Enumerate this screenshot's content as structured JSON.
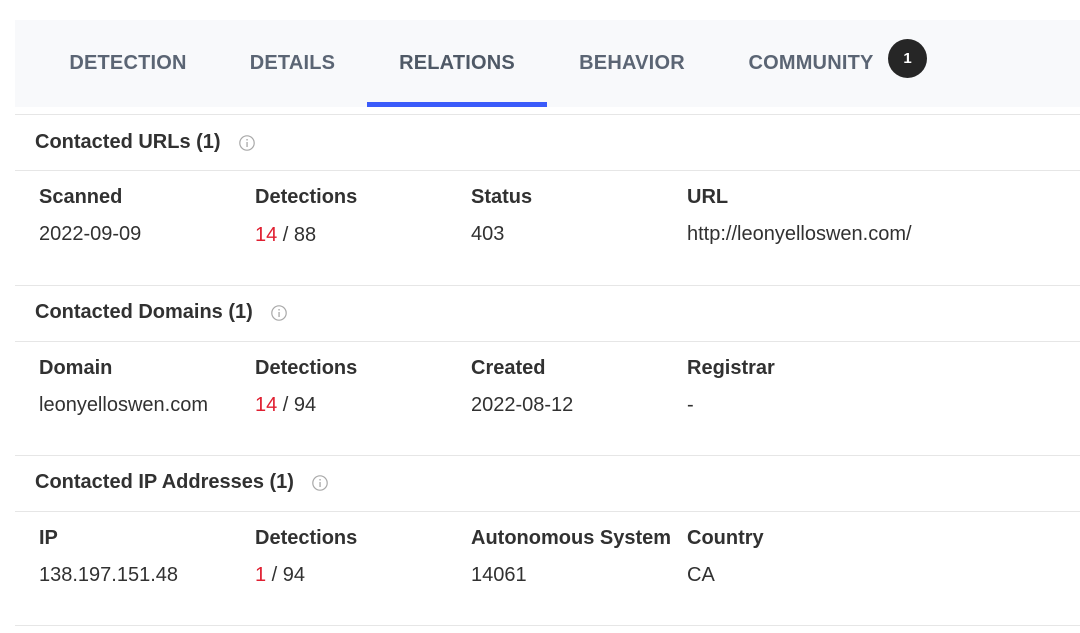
{
  "tabs": [
    {
      "label": "DETECTION"
    },
    {
      "label": "DETAILS"
    },
    {
      "label": "RELATIONS"
    },
    {
      "label": "BEHAVIOR"
    },
    {
      "label": "COMMUNITY"
    }
  ],
  "community_badge": "1",
  "active_tab": "RELATIONS",
  "colors": {
    "accent": "#3b5bfa",
    "malicious": "#e02032",
    "text": "#313131",
    "tab_text": "#5b6574"
  },
  "sections": [
    {
      "title": "Contacted URLs (1)",
      "info_icon": "info-icon",
      "columns": [
        "Scanned",
        "Detections",
        "Status",
        "URL"
      ],
      "rows": [
        {
          "c1": "2022-09-09",
          "det_pos": "14",
          "det_sep": " / ",
          "det_total": "88",
          "c3": "403",
          "c4": "http://leonyelloswen.com/"
        }
      ]
    },
    {
      "title": "Contacted Domains (1)",
      "info_icon": "info-icon",
      "columns": [
        "Domain",
        "Detections",
        "Created",
        "Registrar"
      ],
      "rows": [
        {
          "c1": "leonyelloswen.com",
          "det_pos": "14",
          "det_sep": " / ",
          "det_total": "94",
          "c3": "2022-08-12",
          "c4": "-"
        }
      ]
    },
    {
      "title": "Contacted IP Addresses (1)",
      "info_icon": "info-icon",
      "columns": [
        "IP",
        "Detections",
        "Autonomous System",
        "Country"
      ],
      "rows": [
        {
          "c1": "138.197.151.48",
          "det_pos": "1",
          "det_sep": " / ",
          "det_total": "94",
          "c3": "14061",
          "c4": "CA"
        }
      ]
    }
  ]
}
